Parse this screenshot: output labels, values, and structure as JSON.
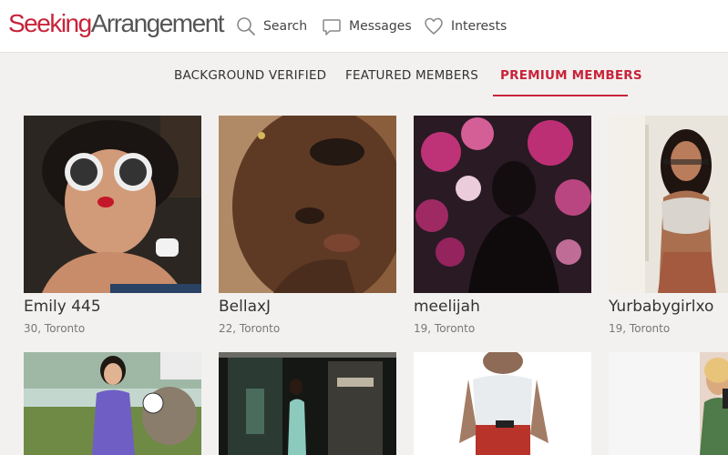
{
  "app": {
    "logo_part1": "Seeking",
    "logo_part2": "Arrangement"
  },
  "nav": {
    "search": "Search",
    "messages": "Messages",
    "interests": "Interests"
  },
  "tabs": [
    {
      "label": "BACKGROUND VERIFIED",
      "active": false
    },
    {
      "label": "FEATURED MEMBERS",
      "active": false
    },
    {
      "label": "PREMIUM MEMBERS",
      "active": true
    }
  ],
  "members": [
    {
      "name": "Emily 445",
      "meta": "30, Toronto"
    },
    {
      "name": "BellaxJ",
      "meta": "22, Toronto"
    },
    {
      "name": "meelijah",
      "meta": "19, Toronto"
    },
    {
      "name": "Yurbabygirlxo",
      "meta": "19, Toronto"
    },
    {
      "name": "",
      "meta": ""
    },
    {
      "name": "",
      "meta": ""
    },
    {
      "name": "",
      "meta": ""
    },
    {
      "name": "",
      "meta": ""
    }
  ],
  "colors": {
    "accent": "#c8233a",
    "background": "#f3f1ef"
  }
}
